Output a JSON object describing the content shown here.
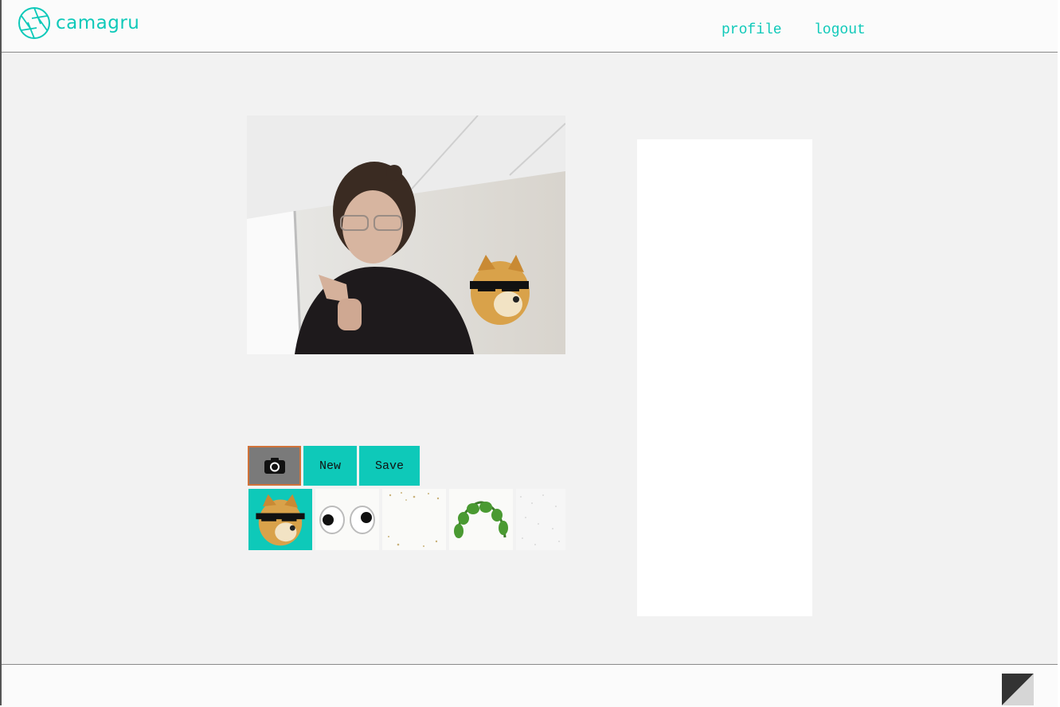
{
  "header": {
    "logo_text": "camagru",
    "nav": {
      "profile": "profile",
      "logout": "logout"
    }
  },
  "main": {
    "photo": {
      "description_icon": "webcam-preview-with-doge-sticker"
    },
    "controls": {
      "camera_icon": "camera-icon",
      "new_label": "New",
      "save_label": "Save"
    },
    "stickers": [
      {
        "name": "doge-sunglasses",
        "selected": true
      },
      {
        "name": "googly-eyes",
        "selected": false
      },
      {
        "name": "confetti",
        "selected": false
      },
      {
        "name": "leaf-crown",
        "selected": false
      },
      {
        "name": "glitter",
        "selected": false
      }
    ]
  },
  "colors": {
    "accent": "#0ec9b9",
    "background": "#f2f2f2",
    "camera_button": "#7a7a7a",
    "camera_button_border": "#d0733a"
  }
}
